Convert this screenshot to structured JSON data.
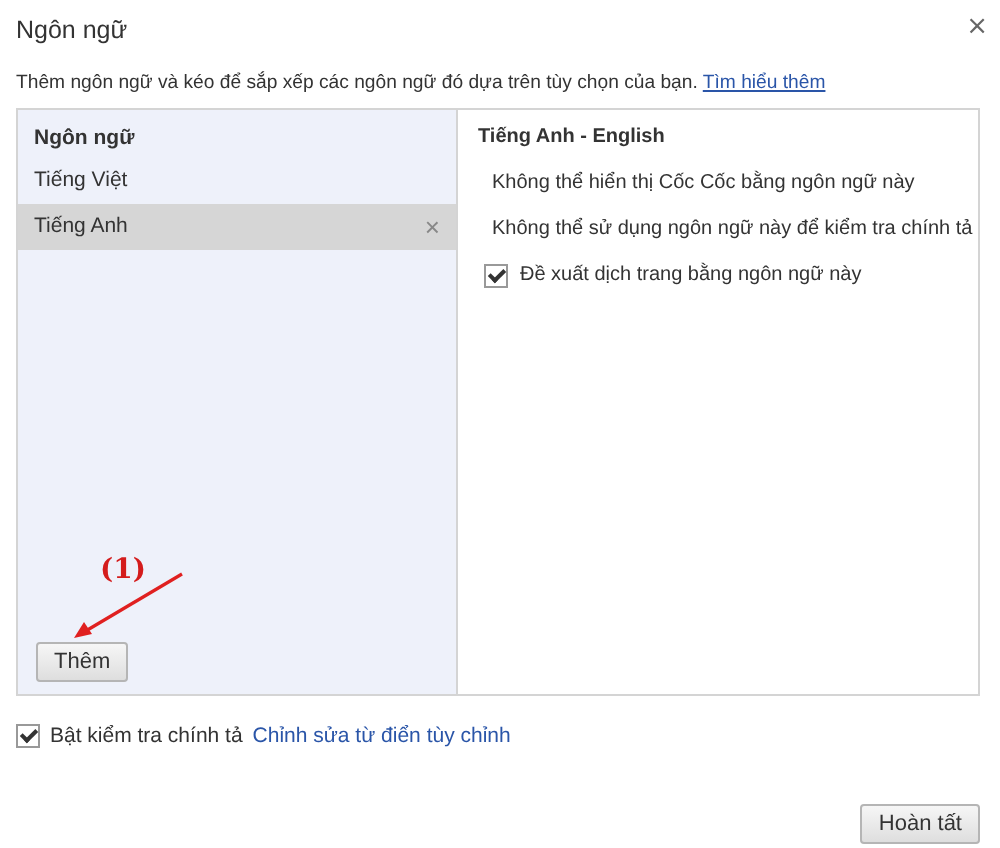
{
  "window": {
    "title": "Ngôn ngữ",
    "close": "×"
  },
  "description": {
    "text": "Thêm ngôn ngữ và kéo để sắp xếp các ngôn ngữ đó dựa trên tùy chọn của bạn.",
    "link": "Tìm hiểu thêm"
  },
  "languages": {
    "header": "Ngôn ngữ",
    "items": [
      {
        "label": "Tiếng Việt",
        "selected": false
      },
      {
        "label": "Tiếng Anh",
        "selected": true,
        "remove": "×"
      }
    ],
    "add_button": "Thêm"
  },
  "details": {
    "title": "Tiếng Anh - English",
    "options": [
      {
        "kind": "note",
        "text": "Không thể hiển thị Cốc Cốc bằng ngôn ngữ này"
      },
      {
        "kind": "note",
        "text": "Không thể sử dụng ngôn ngữ này để kiểm tra chính tả"
      },
      {
        "kind": "checkbox",
        "text": "Đề xuất dịch trang bằng ngôn ngữ này",
        "checked": true
      }
    ]
  },
  "annotation": {
    "text": "(1)"
  },
  "spellcheck": {
    "checked": true,
    "label": "Bật kiểm tra chính tả",
    "link": "Chỉnh sửa từ điển tùy chỉnh"
  },
  "buttons": [
    {
      "label": "Hoàn tất"
    }
  ]
}
